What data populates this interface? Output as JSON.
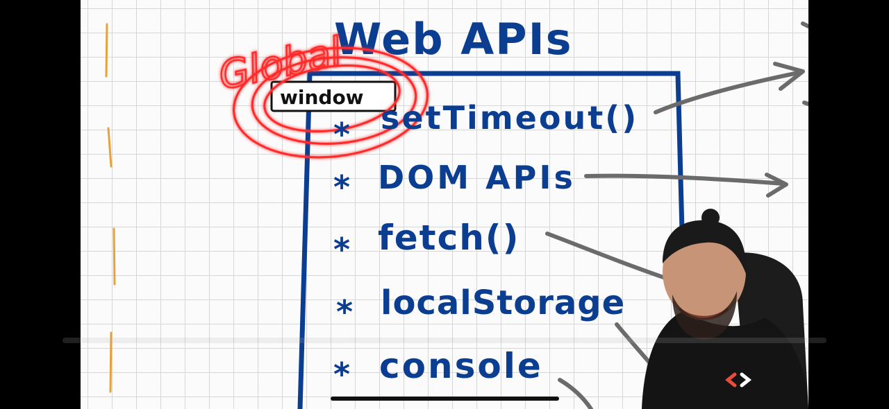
{
  "board": {
    "heading": "Web APIs",
    "global_annotation": "Global",
    "window_label": "window",
    "items": [
      {
        "bullet": "*",
        "label": "setTimeout()"
      },
      {
        "bullet": "*",
        "label": "DOM APIs"
      },
      {
        "bullet": "*",
        "label": "fetch()"
      },
      {
        "bullet": "*",
        "label": "localStorage"
      },
      {
        "bullet": "*",
        "label": "console"
      }
    ]
  },
  "colors": {
    "ink_blue": "#0b3d91",
    "highlight_red": "#ff2a2a",
    "arrow_gray": "#6b6b6b",
    "dash_orange": "#e6a23c"
  },
  "logo_icon": "code-chevron-icon"
}
